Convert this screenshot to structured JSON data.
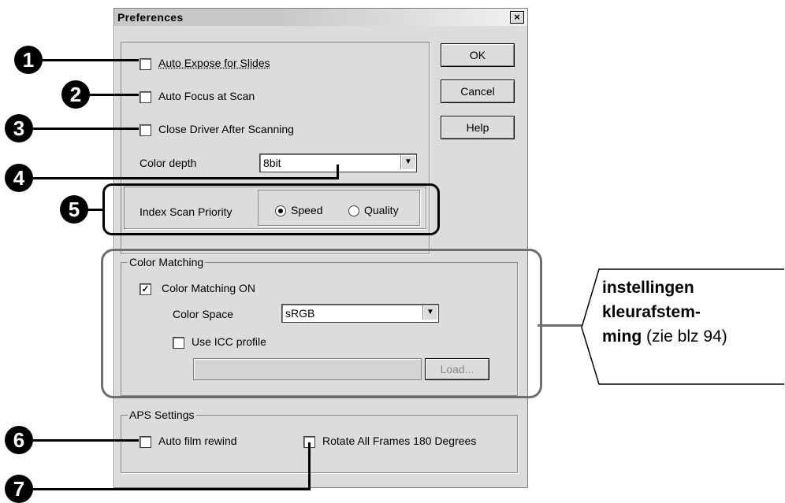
{
  "window": {
    "title": "Preferences",
    "close_glyph": "×"
  },
  "options": {
    "auto_expose": {
      "label": "Auto Expose for Slides",
      "checked": false
    },
    "auto_focus": {
      "label": "Auto Focus at Scan",
      "checked": false
    },
    "close_driver": {
      "label": "Close Driver After Scanning",
      "checked": false
    }
  },
  "color_depth": {
    "label": "Color depth",
    "value": "8bit"
  },
  "index_scan": {
    "label": "Index Scan Priority",
    "speed": "Speed",
    "quality": "Quality",
    "selected": "Speed"
  },
  "buttons": {
    "ok": "OK",
    "cancel": "Cancel",
    "help": "Help",
    "load": "Load..."
  },
  "color_matching": {
    "legend": "Color Matching",
    "on_label": "Color Matching ON",
    "on_checked": true,
    "space_label": "Color Space",
    "space_value": "sRGB",
    "icc_label": "Use ICC profile",
    "icc_checked": false,
    "profile_path": ""
  },
  "aps": {
    "legend": "APS Settings",
    "rewind_label": "Auto film rewind",
    "rotate_label": "Rotate All Frames 180 Degrees"
  },
  "callouts": [
    "1",
    "2",
    "3",
    "4",
    "5",
    "6",
    "7"
  ],
  "annotation": {
    "bold_1": "instellingen",
    "bold_2": "kleurafstem-",
    "bold_3": "ming",
    "normal": " (zie blz 94)"
  },
  "check_glyph": "✓",
  "colors": {
    "dialog": "#dcdcdc",
    "callout": "#000000",
    "frame_grey": "#6e6e6e"
  }
}
